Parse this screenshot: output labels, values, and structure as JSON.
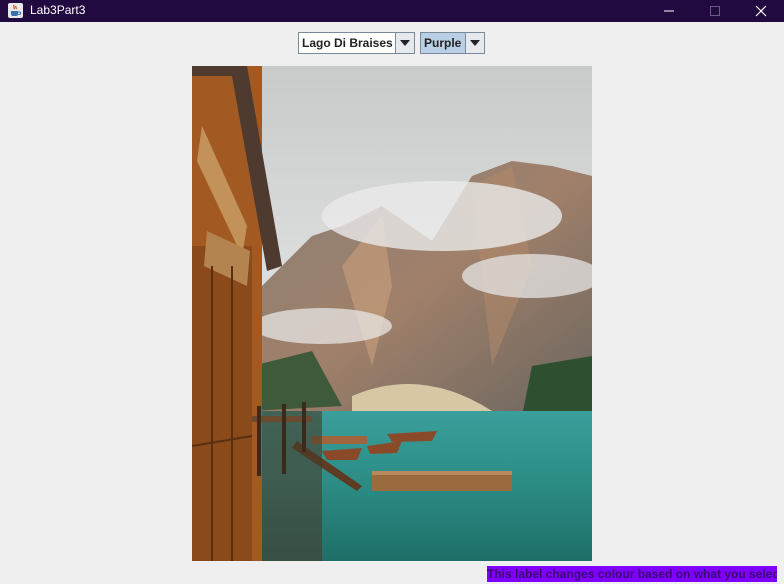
{
  "window": {
    "title": "Lab3Part3",
    "icon": "java-cup-icon",
    "controls": [
      "minimize-icon",
      "maximize-icon",
      "close-icon"
    ]
  },
  "location_select": {
    "selected": "Lago Di Braises",
    "icon": "chevron-down-icon"
  },
  "colour_select": {
    "selected": "Purple",
    "icon": "chevron-down-icon"
  },
  "photo": {
    "subject": "lake-with-mountains-and-boathouse-photo"
  },
  "status_label": {
    "text": "This label changes colour based on what you selec",
    "background": "#8000ff"
  },
  "colors": {
    "titlebar": "#200a40",
    "window_bg": "#efefef",
    "selected_item_highlight": "#b8cfe5"
  }
}
